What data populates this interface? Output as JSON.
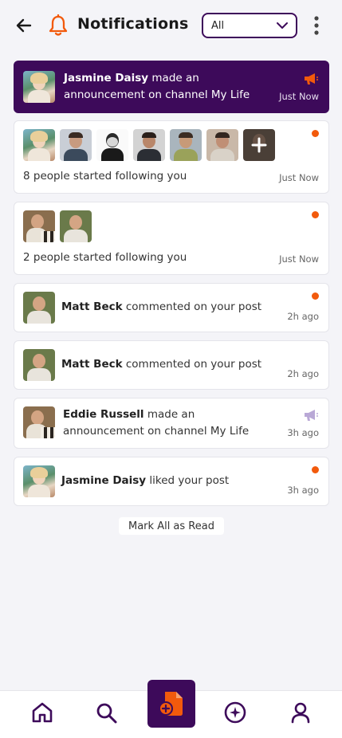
{
  "header": {
    "title": "Notifications",
    "filter_value": "All"
  },
  "notifications": [
    {
      "type": "announcement",
      "name": "Jasmine Daisy",
      "text": "made an announcement on channel My Life",
      "time": "Just Now",
      "highlight": true
    },
    {
      "type": "follow",
      "text": "8 people started following you",
      "time": "Just Now",
      "unread": true
    },
    {
      "type": "follow",
      "text": "2 people started following you",
      "time": "Just Now",
      "unread": true
    },
    {
      "type": "comment",
      "name": "Matt Beck",
      "text": "commented on your post",
      "time": "2h ago",
      "unread": true
    },
    {
      "type": "comment",
      "name": "Matt Beck",
      "text": "commented on your post",
      "time": "2h ago",
      "unread": false
    },
    {
      "type": "announcement",
      "name": "Eddie Russell",
      "text": "made an announcement on channel My Life",
      "time": "3h ago",
      "unread": false
    },
    {
      "type": "like",
      "name": "Jasmine Daisy",
      "text": "liked your post",
      "time": "3h ago",
      "unread": true
    }
  ],
  "mark_all_label": "Mark All as Read",
  "colors": {
    "primary": "#3d0a5a",
    "accent": "#f25a0c",
    "megaphone_muted": "#b9a8d6"
  },
  "bottom_nav": [
    "home-icon",
    "search-icon",
    "add-post-icon",
    "explore-icon",
    "profile-icon"
  ]
}
